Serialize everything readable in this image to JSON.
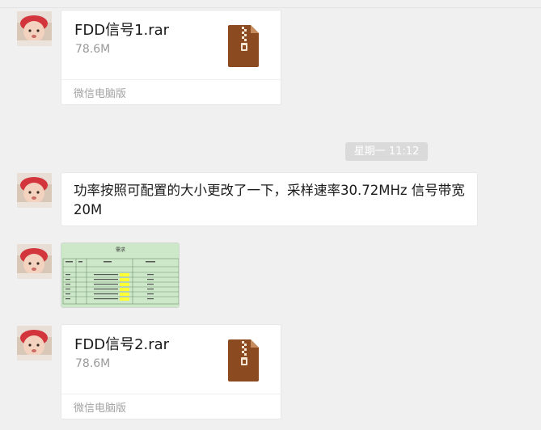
{
  "messages": {
    "file1": {
      "name": "FDD信号1.rar",
      "size": "78.6M",
      "source": "微信电脑版",
      "icon": "zip-archive-icon"
    },
    "timestamp": "星期一 11:12",
    "text": "功率按照可配置的大小更改了一下，采样速率30.72MHz 信号带宽20M",
    "image": {
      "title": "需求",
      "icon": "image-thumbnail"
    },
    "file2": {
      "name": "FDD信号2.rar",
      "size": "78.6M",
      "source": "微信电脑版",
      "icon": "zip-archive-icon"
    }
  },
  "colors": {
    "background": "#f0f0f0",
    "bubble": "#ffffff",
    "archive_icon": "#8b4a20",
    "timestamp_bg": "#dadada"
  }
}
